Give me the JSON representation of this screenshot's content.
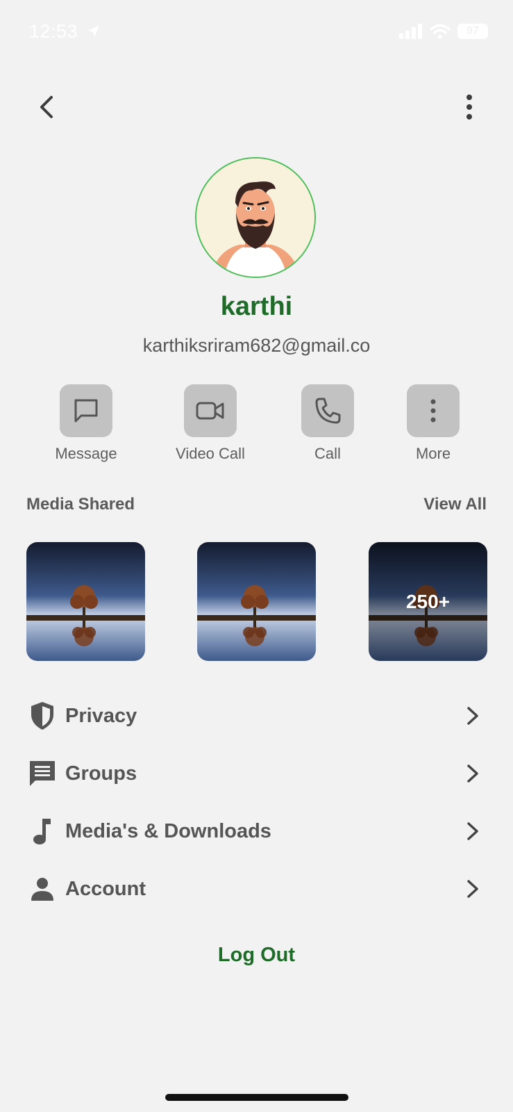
{
  "status_bar": {
    "time": "12:53",
    "battery": "97"
  },
  "profile": {
    "name": "karthi",
    "email": "karthiksriram682@gmail.co"
  },
  "actions": [
    {
      "label": "Message",
      "icon": "message-icon"
    },
    {
      "label": "Video Call",
      "icon": "video-call-icon"
    },
    {
      "label": "Call",
      "icon": "phone-icon"
    },
    {
      "label": "More",
      "icon": "more-vertical-icon"
    }
  ],
  "media": {
    "title": "Media Shared",
    "view_all": "View All",
    "overflow_count": "250+"
  },
  "menu": [
    {
      "label": "Privacy",
      "icon": "shield-icon"
    },
    {
      "label": "Groups",
      "icon": "chat-icon"
    },
    {
      "label": "Media's & Downloads",
      "icon": "music-note-icon"
    },
    {
      "label": "Account",
      "icon": "person-icon"
    }
  ],
  "logout": "Log Out",
  "colors": {
    "accent": "#1f6b2a",
    "avatar_ring": "#4cbf5a",
    "background": "#f2f2f2"
  }
}
